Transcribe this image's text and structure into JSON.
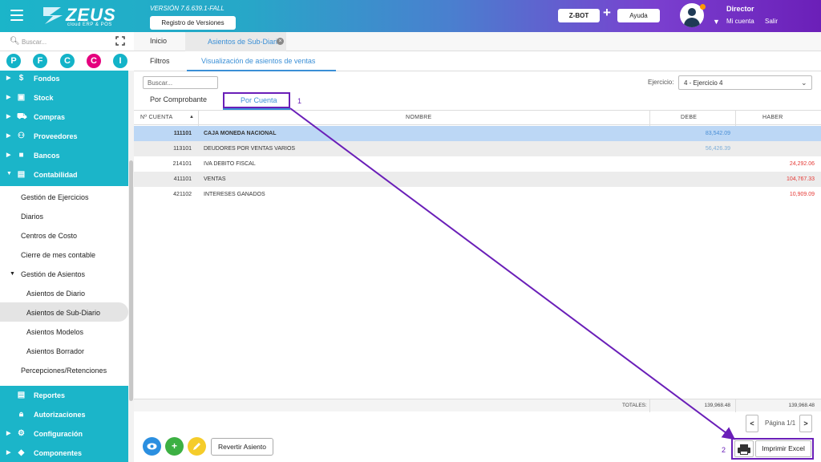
{
  "header": {
    "logo_text": "ZEUS",
    "logo_sub": "cloud ERP & POS",
    "version": "VERSIÓN 7.6.639.1-FALL",
    "registro_btn": "Registro de Versiones",
    "zbot_btn": "Z-BOT",
    "plus": "+",
    "ayuda_btn": "Ayuda",
    "user_name": "Director",
    "mi_cuenta": "Mi cuenta",
    "salir": "Salir"
  },
  "sidebar": {
    "search_placeholder": "Buscar...",
    "shortcuts": [
      {
        "letter": "P",
        "color": "#13b3c8"
      },
      {
        "letter": "F",
        "color": "#13b3c8"
      },
      {
        "letter": "C",
        "color": "#13b3c8"
      },
      {
        "letter": "C",
        "color": "#e5007e"
      },
      {
        "letter": "I",
        "color": "#13b3c8"
      }
    ],
    "top_items": [
      {
        "label": "Fondos",
        "icon": "dollar-icon"
      },
      {
        "label": "Stock",
        "icon": "box-icon"
      },
      {
        "label": "Compras",
        "icon": "cart-icon"
      },
      {
        "label": "Proveedores",
        "icon": "people-icon"
      },
      {
        "label": "Bancos",
        "icon": "briefcase-icon"
      },
      {
        "label": "Contabilidad",
        "icon": "book-icon"
      }
    ],
    "contabilidad_items": [
      "Gestión de Ejercicios",
      "Diarios",
      "Centros de Costo",
      "Cierre de mes contable",
      "Gestión de Asientos",
      "Asientos de Diario",
      "Asientos de Sub-Diario",
      "Asientos Modelos",
      "Asientos Borrador",
      "Percepciones/Retenciones"
    ],
    "bottom_items": [
      {
        "label": "Reportes",
        "icon": "report-icon"
      },
      {
        "label": "Autorizaciones",
        "icon": "lock-icon"
      },
      {
        "label": "Configuración",
        "icon": "gears-icon"
      },
      {
        "label": "Componentes",
        "icon": "puzzle-icon"
      }
    ]
  },
  "tabs": {
    "inicio": "Inicio",
    "active": "Asientos de Sub-Diario"
  },
  "subtabs": {
    "filtros": "Filtros",
    "active": "Visualización de asientos de ventas"
  },
  "toolbar": {
    "search_placeholder": "Buscar...",
    "ejercicio_label": "Ejercicio:",
    "ejercicio_value": "4 - Ejercicio 4"
  },
  "view_tabs": {
    "comprobante": "Por Comprobante",
    "cuenta": "Por Cuenta"
  },
  "annotations": {
    "one": "1",
    "two": "2"
  },
  "table": {
    "headers": [
      "Nº CUENTA",
      "NOMBRE",
      "DEBE",
      "HABER"
    ],
    "rows": [
      {
        "cuenta": "111101",
        "nombre": "CAJA MONEDA NACIONAL",
        "debe": "83,542.09",
        "haber": ""
      },
      {
        "cuenta": "113101",
        "nombre": "DEUDORES POR VENTAS VARIOS",
        "debe": "56,426.39",
        "haber": ""
      },
      {
        "cuenta": "214101",
        "nombre": "IVA DEBITO FISCAL",
        "debe": "",
        "haber": "24,292.06"
      },
      {
        "cuenta": "411101",
        "nombre": "VENTAS",
        "debe": "",
        "haber": "104,767.33"
      },
      {
        "cuenta": "421102",
        "nombre": "INTERESES GANADOS",
        "debe": "",
        "haber": "10,909.09"
      }
    ],
    "totals_label": "TOTALES:",
    "total_debe": "139,968.48",
    "total_haber": "139,968.48"
  },
  "pager": {
    "prev": "<",
    "text": "Página 1/1",
    "next": ">"
  },
  "actions": {
    "revertir": "Revertir Asiento",
    "imprimir_excel": "Imprimir Excel"
  },
  "colors": {
    "annotation": "#6a1fb8",
    "accent": "#3a8fd6",
    "teal": "#1bb5c9"
  }
}
